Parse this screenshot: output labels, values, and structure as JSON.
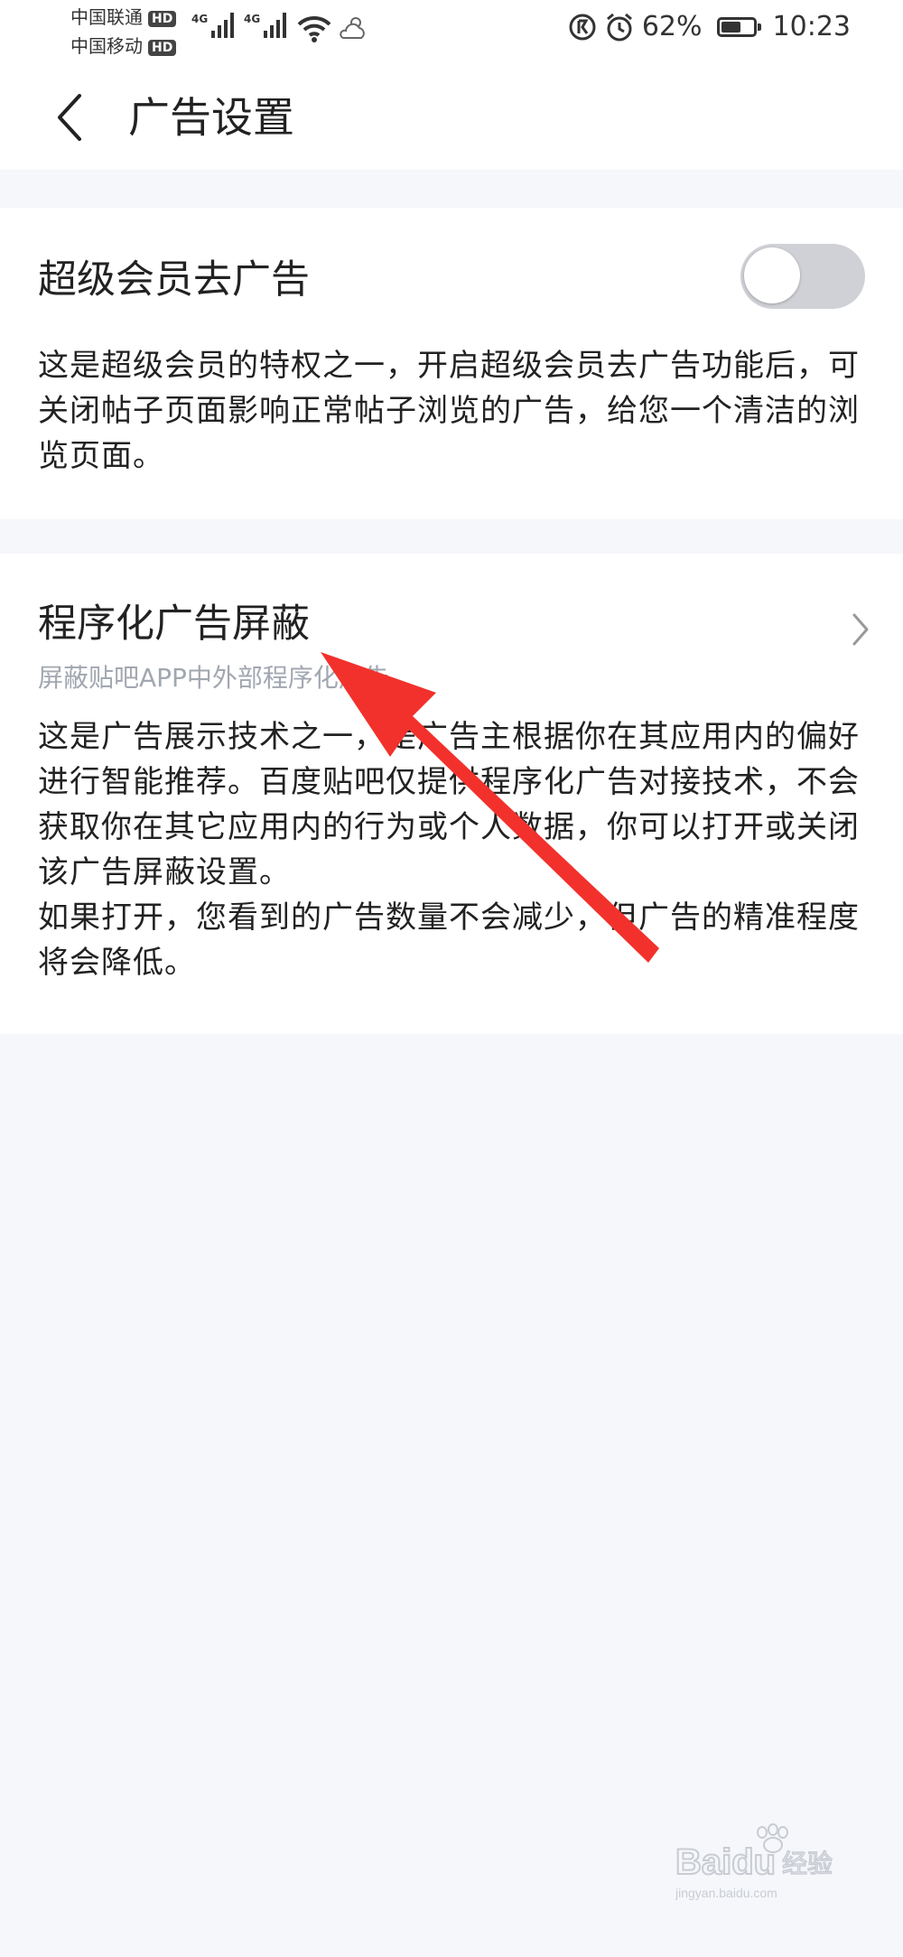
{
  "status_bar": {
    "carrier_1": "中国联通",
    "carrier_2": "中国移动",
    "hd_1": "HD",
    "hd_2": "HD",
    "network_1": "4G",
    "network_2": "4G",
    "battery_percent": "62%",
    "battery_level": 0.62,
    "time": "10:23",
    "icons": [
      "signal-icon",
      "wifi-icon",
      "weather-icon",
      "data-saver-icon",
      "alarm-icon",
      "battery-icon"
    ]
  },
  "header": {
    "title": "广告设置",
    "back_icon": "chevron-left-icon"
  },
  "settings": {
    "super_member": {
      "title": "超级会员去广告",
      "toggle_on": false,
      "description": "这是超级会员的特权之一，开启超级会员去广告功能后，可关闭帖子页面影响正常帖子浏览的广告，给您一个清洁的浏览页面。"
    },
    "programmatic": {
      "title": "程序化广告屏蔽",
      "subtitle": "屏蔽贴吧APP中外部程序化广告",
      "description_1": "这是广告展示技术之一，是广告主根据你在其应用内的偏好进行智能推荐。百度贴吧仅提供程序化广告对接技术，不会获取你在其它应用内的行为或个人数据，你可以打开或关闭该广告屏蔽设置。",
      "description_2": "如果打开，您看到的广告数量不会减少，但广告的精准程度将会降低。",
      "chevron_icon": "chevron-right-icon"
    }
  },
  "colors": {
    "page_bg": "#f5f7fb",
    "card_bg": "#ffffff",
    "toggle_off": "#cfd1d6",
    "subtitle": "#a2a7b0",
    "annotation_arrow": "#f2312c"
  },
  "watermark": {
    "text_1": "Baidu",
    "text_2": "经验",
    "text_3": "jingyan.baidu.com"
  }
}
